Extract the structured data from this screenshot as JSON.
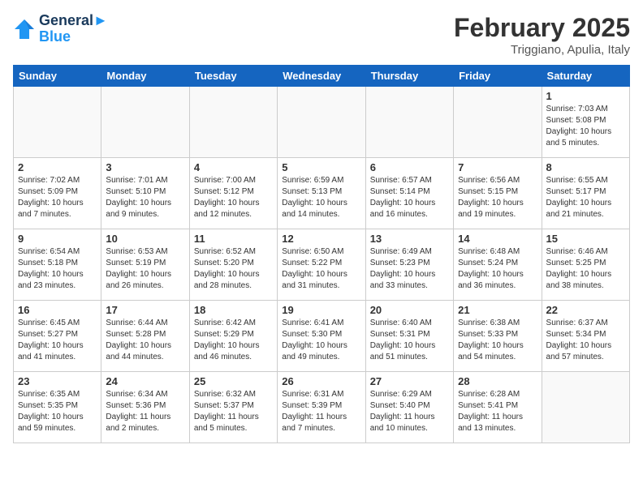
{
  "header": {
    "logo_line1": "General",
    "logo_line2": "Blue",
    "month": "February 2025",
    "location": "Triggiano, Apulia, Italy"
  },
  "weekdays": [
    "Sunday",
    "Monday",
    "Tuesday",
    "Wednesday",
    "Thursday",
    "Friday",
    "Saturday"
  ],
  "weeks": [
    [
      {
        "day": "",
        "info": ""
      },
      {
        "day": "",
        "info": ""
      },
      {
        "day": "",
        "info": ""
      },
      {
        "day": "",
        "info": ""
      },
      {
        "day": "",
        "info": ""
      },
      {
        "day": "",
        "info": ""
      },
      {
        "day": "1",
        "info": "Sunrise: 7:03 AM\nSunset: 5:08 PM\nDaylight: 10 hours\nand 5 minutes."
      }
    ],
    [
      {
        "day": "2",
        "info": "Sunrise: 7:02 AM\nSunset: 5:09 PM\nDaylight: 10 hours\nand 7 minutes."
      },
      {
        "day": "3",
        "info": "Sunrise: 7:01 AM\nSunset: 5:10 PM\nDaylight: 10 hours\nand 9 minutes."
      },
      {
        "day": "4",
        "info": "Sunrise: 7:00 AM\nSunset: 5:12 PM\nDaylight: 10 hours\nand 12 minutes."
      },
      {
        "day": "5",
        "info": "Sunrise: 6:59 AM\nSunset: 5:13 PM\nDaylight: 10 hours\nand 14 minutes."
      },
      {
        "day": "6",
        "info": "Sunrise: 6:57 AM\nSunset: 5:14 PM\nDaylight: 10 hours\nand 16 minutes."
      },
      {
        "day": "7",
        "info": "Sunrise: 6:56 AM\nSunset: 5:15 PM\nDaylight: 10 hours\nand 19 minutes."
      },
      {
        "day": "8",
        "info": "Sunrise: 6:55 AM\nSunset: 5:17 PM\nDaylight: 10 hours\nand 21 minutes."
      }
    ],
    [
      {
        "day": "9",
        "info": "Sunrise: 6:54 AM\nSunset: 5:18 PM\nDaylight: 10 hours\nand 23 minutes."
      },
      {
        "day": "10",
        "info": "Sunrise: 6:53 AM\nSunset: 5:19 PM\nDaylight: 10 hours\nand 26 minutes."
      },
      {
        "day": "11",
        "info": "Sunrise: 6:52 AM\nSunset: 5:20 PM\nDaylight: 10 hours\nand 28 minutes."
      },
      {
        "day": "12",
        "info": "Sunrise: 6:50 AM\nSunset: 5:22 PM\nDaylight: 10 hours\nand 31 minutes."
      },
      {
        "day": "13",
        "info": "Sunrise: 6:49 AM\nSunset: 5:23 PM\nDaylight: 10 hours\nand 33 minutes."
      },
      {
        "day": "14",
        "info": "Sunrise: 6:48 AM\nSunset: 5:24 PM\nDaylight: 10 hours\nand 36 minutes."
      },
      {
        "day": "15",
        "info": "Sunrise: 6:46 AM\nSunset: 5:25 PM\nDaylight: 10 hours\nand 38 minutes."
      }
    ],
    [
      {
        "day": "16",
        "info": "Sunrise: 6:45 AM\nSunset: 5:27 PM\nDaylight: 10 hours\nand 41 minutes."
      },
      {
        "day": "17",
        "info": "Sunrise: 6:44 AM\nSunset: 5:28 PM\nDaylight: 10 hours\nand 44 minutes."
      },
      {
        "day": "18",
        "info": "Sunrise: 6:42 AM\nSunset: 5:29 PM\nDaylight: 10 hours\nand 46 minutes."
      },
      {
        "day": "19",
        "info": "Sunrise: 6:41 AM\nSunset: 5:30 PM\nDaylight: 10 hours\nand 49 minutes."
      },
      {
        "day": "20",
        "info": "Sunrise: 6:40 AM\nSunset: 5:31 PM\nDaylight: 10 hours\nand 51 minutes."
      },
      {
        "day": "21",
        "info": "Sunrise: 6:38 AM\nSunset: 5:33 PM\nDaylight: 10 hours\nand 54 minutes."
      },
      {
        "day": "22",
        "info": "Sunrise: 6:37 AM\nSunset: 5:34 PM\nDaylight: 10 hours\nand 57 minutes."
      }
    ],
    [
      {
        "day": "23",
        "info": "Sunrise: 6:35 AM\nSunset: 5:35 PM\nDaylight: 10 hours\nand 59 minutes."
      },
      {
        "day": "24",
        "info": "Sunrise: 6:34 AM\nSunset: 5:36 PM\nDaylight: 11 hours\nand 2 minutes."
      },
      {
        "day": "25",
        "info": "Sunrise: 6:32 AM\nSunset: 5:37 PM\nDaylight: 11 hours\nand 5 minutes."
      },
      {
        "day": "26",
        "info": "Sunrise: 6:31 AM\nSunset: 5:39 PM\nDaylight: 11 hours\nand 7 minutes."
      },
      {
        "day": "27",
        "info": "Sunrise: 6:29 AM\nSunset: 5:40 PM\nDaylight: 11 hours\nand 10 minutes."
      },
      {
        "day": "28",
        "info": "Sunrise: 6:28 AM\nSunset: 5:41 PM\nDaylight: 11 hours\nand 13 minutes."
      },
      {
        "day": "",
        "info": ""
      }
    ]
  ]
}
